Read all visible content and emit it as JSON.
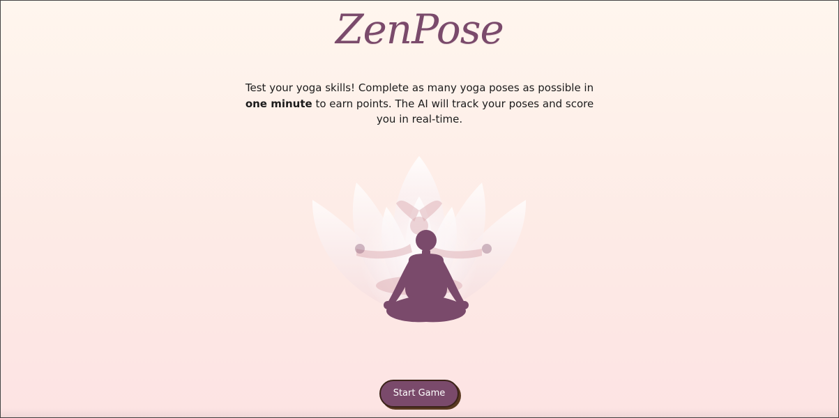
{
  "header": {
    "logo_text": "ZenPose"
  },
  "intro": {
    "text_before": "Test your yoga skills! Complete as many yoga poses as possible in ",
    "emphasis": "one minute",
    "text_after": " to earn points. The AI will track your poses and score you in real-time."
  },
  "illustration": {
    "icon": "meditation-lotus-icon"
  },
  "actions": {
    "start_label": "Start Game"
  },
  "colors": {
    "brand": "#7a4a6b",
    "button_border": "#3b2319",
    "background_top": "#fff6ee",
    "background_bottom": "#fde3e3"
  }
}
